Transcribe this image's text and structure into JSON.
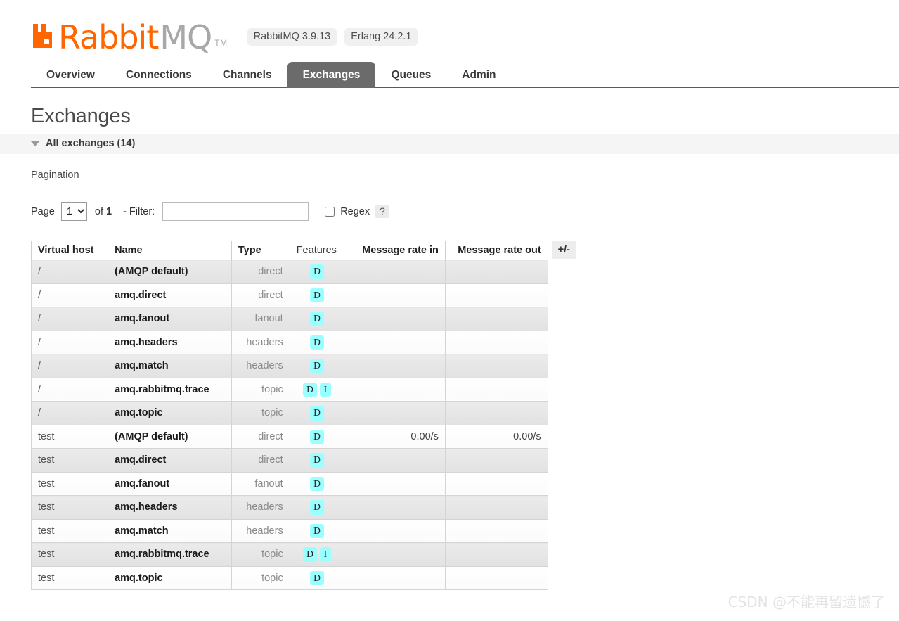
{
  "brand": {
    "logo_rabbit": "Rabbit",
    "logo_mq": "MQ",
    "trademark": "TM",
    "version_rabbitmq": "RabbitMQ 3.9.13",
    "version_erlang": "Erlang 24.2.1",
    "accent_color": "#ff6600",
    "logo_gray": "#a8a8a8"
  },
  "nav": {
    "items": [
      {
        "label": "Overview",
        "active": false
      },
      {
        "label": "Connections",
        "active": false
      },
      {
        "label": "Channels",
        "active": false
      },
      {
        "label": "Exchanges",
        "active": true
      },
      {
        "label": "Queues",
        "active": false
      },
      {
        "label": "Admin",
        "active": false
      }
    ],
    "active_bg": "#6b6b6b"
  },
  "main": {
    "page_title": "Exchanges",
    "section_label": "All exchanges (14)",
    "caret_icon": "triangle-down-icon",
    "pagination_heading": "Pagination"
  },
  "pagination": {
    "page_label": "Page",
    "page_value": "1",
    "page_options": [
      "1"
    ],
    "of_text": "of",
    "total_pages": "1",
    "filter_label": "- Filter:",
    "filter_value": "",
    "filter_placeholder": "",
    "regex_label": "Regex",
    "regex_checked": false,
    "help_label": "?"
  },
  "table": {
    "columns": [
      "Virtual host",
      "Name",
      "Type",
      "Features",
      "Message rate in",
      "Message rate out"
    ],
    "plusminus_label": "+/-",
    "feature_badge_color": "#99ffff",
    "rows": [
      {
        "vhost": "/",
        "name": "(AMQP default)",
        "type": "direct",
        "features": [
          "D"
        ],
        "rate_in": "",
        "rate_out": ""
      },
      {
        "vhost": "/",
        "name": "amq.direct",
        "type": "direct",
        "features": [
          "D"
        ],
        "rate_in": "",
        "rate_out": ""
      },
      {
        "vhost": "/",
        "name": "amq.fanout",
        "type": "fanout",
        "features": [
          "D"
        ],
        "rate_in": "",
        "rate_out": ""
      },
      {
        "vhost": "/",
        "name": "amq.headers",
        "type": "headers",
        "features": [
          "D"
        ],
        "rate_in": "",
        "rate_out": ""
      },
      {
        "vhost": "/",
        "name": "amq.match",
        "type": "headers",
        "features": [
          "D"
        ],
        "rate_in": "",
        "rate_out": ""
      },
      {
        "vhost": "/",
        "name": "amq.rabbitmq.trace",
        "type": "topic",
        "features": [
          "D",
          "I"
        ],
        "rate_in": "",
        "rate_out": ""
      },
      {
        "vhost": "/",
        "name": "amq.topic",
        "type": "topic",
        "features": [
          "D"
        ],
        "rate_in": "",
        "rate_out": ""
      },
      {
        "vhost": "test",
        "name": "(AMQP default)",
        "type": "direct",
        "features": [
          "D"
        ],
        "rate_in": "0.00/s",
        "rate_out": "0.00/s"
      },
      {
        "vhost": "test",
        "name": "amq.direct",
        "type": "direct",
        "features": [
          "D"
        ],
        "rate_in": "",
        "rate_out": ""
      },
      {
        "vhost": "test",
        "name": "amq.fanout",
        "type": "fanout",
        "features": [
          "D"
        ],
        "rate_in": "",
        "rate_out": ""
      },
      {
        "vhost": "test",
        "name": "amq.headers",
        "type": "headers",
        "features": [
          "D"
        ],
        "rate_in": "",
        "rate_out": ""
      },
      {
        "vhost": "test",
        "name": "amq.match",
        "type": "headers",
        "features": [
          "D"
        ],
        "rate_in": "",
        "rate_out": ""
      },
      {
        "vhost": "test",
        "name": "amq.rabbitmq.trace",
        "type": "topic",
        "features": [
          "D",
          "I"
        ],
        "rate_in": "",
        "rate_out": ""
      },
      {
        "vhost": "test",
        "name": "amq.topic",
        "type": "topic",
        "features": [
          "D"
        ],
        "rate_in": "",
        "rate_out": ""
      }
    ]
  },
  "watermark": {
    "text": "CSDN @不能再留遗憾了"
  }
}
